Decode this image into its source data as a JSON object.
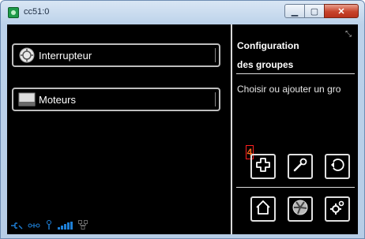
{
  "window": {
    "title": "cc51:0",
    "icons": [
      "minimize-icon",
      "maximize-icon",
      "close-icon"
    ]
  },
  "groups": [
    {
      "label": "Interrupteur",
      "icon": "switch-icon"
    },
    {
      "label": "Moteurs",
      "icon": "shutter-icon"
    }
  ],
  "panel": {
    "title_line1": "Configuration",
    "title_line2": "des groupes",
    "description": "Choisir ou ajouter un gro",
    "badge": "4",
    "row1": [
      "add-icon",
      "wrench-icon",
      "undo-icon"
    ],
    "row2": [
      "home-icon",
      "fan-icon",
      "settings-icon"
    ]
  },
  "status_icons": [
    "connection-icon",
    "network-icon",
    "antenna-icon",
    "signal-bars-icon",
    "lan-icon"
  ],
  "colors": {
    "background": "#000000",
    "accent": "#1e7fd6",
    "close": "#c7432b",
    "badge": "#ff2020"
  }
}
